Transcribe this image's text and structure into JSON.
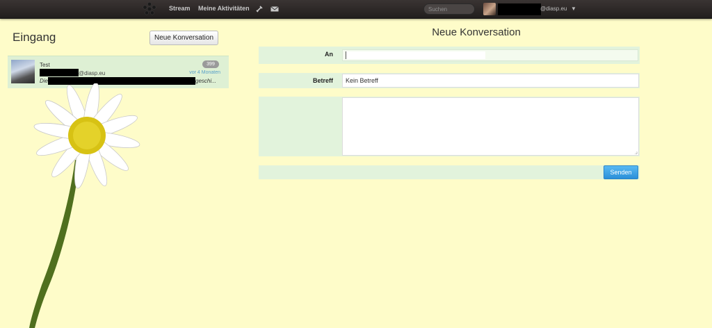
{
  "topbar": {
    "stream_label": "Stream",
    "activities_label": "Meine Aktivitäten",
    "search_placeholder": "Suchen",
    "user_suffix": "@diasp.eu",
    "caret": "▼",
    "logo_icon": "asterisk-icon"
  },
  "inbox": {
    "title": "Eingang",
    "new_conversation_label": "Neue Konversation",
    "conversations": [
      {
        "subject": "Test",
        "unread_count": "399",
        "sender_suffix": "@diasp.eu",
        "time": "vor 4 Monaten",
        "preview_start": "Die",
        "preview_end": "geschi..."
      }
    ]
  },
  "form": {
    "title": "Neue Konversation",
    "to_label": "An",
    "subject_label": "Betreff",
    "subject_value": "Kein Betreff",
    "send_label": "Senden"
  },
  "colors": {
    "background": "#fefcc9",
    "row_bg": "#e2f3dc",
    "send_button": "#2b8fd8",
    "badge": "#9a9a9a"
  }
}
